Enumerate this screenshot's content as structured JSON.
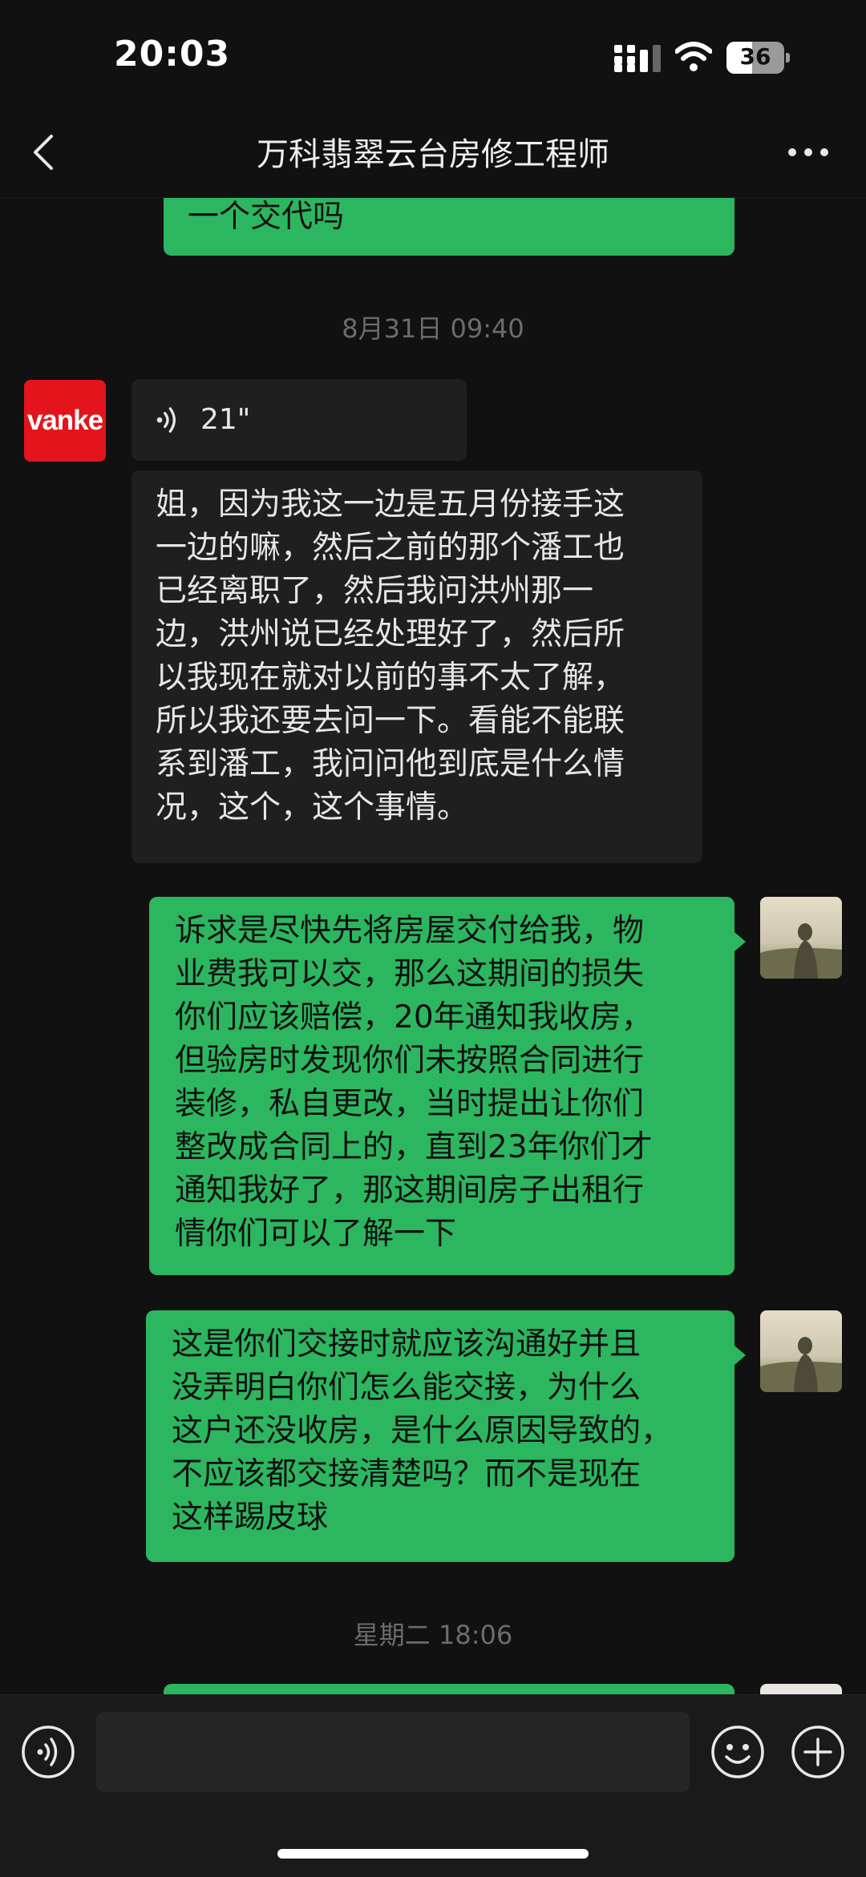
{
  "status_bar": {
    "time": "20:03",
    "battery": "36"
  },
  "header": {
    "title": "万科翡翠云台房修工程师"
  },
  "messages": [
    {
      "from": "me",
      "text": "一个交代吗"
    },
    {
      "timestamp": "8月31日 09:40"
    },
    {
      "from": "other",
      "voice_duration": "21\"",
      "avatar_text": "vanke"
    },
    {
      "from": "other",
      "lines": [
        "姐，因为我这一边是五月份接手这",
        "一边的嘛，然后之前的那个潘工也",
        "已经离职了，然后我问洪州那一",
        "边，洪州说已经处理好了，然后所",
        "以我现在就对以前的事不太了解，",
        "所以我还要去问一下。看能不能联",
        "系到潘工，我问问他到底是什么情",
        "况，这个，这个事情。"
      ]
    },
    {
      "from": "me",
      "lines": [
        "诉求是尽快先将房屋交付给我，物",
        "业费我可以交，那么这期间的损失",
        "你们应该赔偿，20年通知我收房，",
        "但验房时发现你们未按照合同进行",
        "装修，私自更改，当时提出让你们",
        "整改成合同上的，直到23年你们才",
        "通知我好了，那这期间房子出租行",
        "情你们可以了解一下"
      ]
    },
    {
      "from": "me",
      "lines": [
        "这是你们交接时就应该沟通好并且",
        "没弄明白你们怎么能交接，为什么",
        "这户还没收房，是什么原因导致的，",
        "不应该都交接清楚吗？而不是现在",
        "这样踢皮球"
      ]
    },
    {
      "timestamp": "星期二 18:06"
    }
  ],
  "input": {
    "placeholder": ""
  },
  "colors": {
    "background": "#111111",
    "my_bubble": "#2cb660",
    "other_bubble": "#1f1f1f",
    "vanke_red": "#e3141b"
  },
  "icons": [
    "back-icon",
    "more-icon",
    "voice-icon",
    "emoji-icon",
    "plus-icon",
    "signal-icon",
    "wifi-icon",
    "battery-icon"
  ]
}
